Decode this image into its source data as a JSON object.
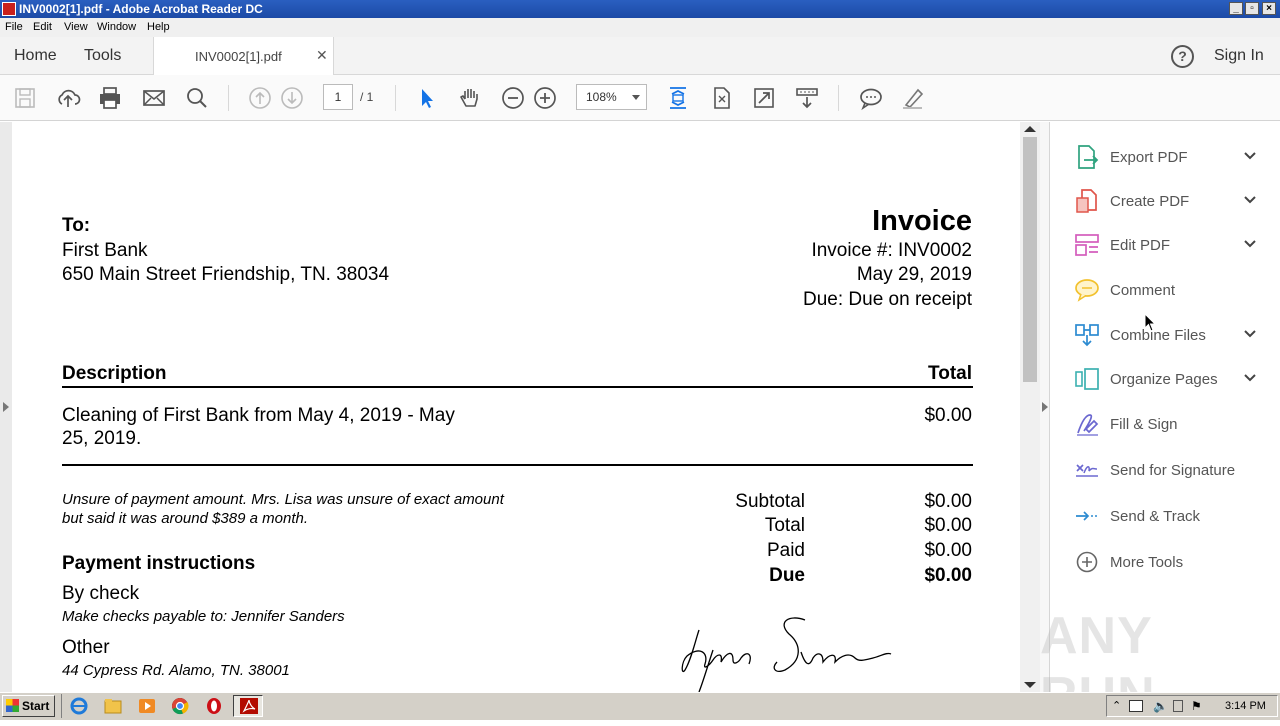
{
  "window": {
    "title": "INV0002[1].pdf - Adobe Acrobat Reader DC"
  },
  "menu": [
    "File",
    "Edit",
    "View",
    "Window",
    "Help"
  ],
  "tabs": {
    "home": "Home",
    "tools": "Tools",
    "doc": "INV0002[1].pdf",
    "sign_in": "Sign In"
  },
  "toolbar": {
    "page_current": "1",
    "page_total": "/ 1",
    "zoom": "108%"
  },
  "invoice": {
    "to_label": "To:",
    "to_name": "First Bank",
    "to_address": "650 Main Street Friendship, TN. 38034",
    "heading": "Invoice",
    "number": "Invoice #: INV0002",
    "date": "May 29, 2019",
    "due": "Due: Due on receipt",
    "col_description": "Description",
    "col_total": "Total",
    "item_line1": "Cleaning of First Bank from May 4, 2019 - May",
    "item_line2": "25, 2019.",
    "item_total": "$0.00",
    "note_line1": "Unsure of payment amount. Mrs. Lisa was unsure of exact amount",
    "note_line2": "but said it was around $389 a month.",
    "summary": [
      {
        "label": "Subtotal",
        "value": "$0.00"
      },
      {
        "label": "Total",
        "value": "$0.00"
      },
      {
        "label": "Paid",
        "value": "$0.00"
      },
      {
        "label": "Due",
        "value": "$0.00"
      }
    ],
    "payment_heading": "Payment instructions",
    "by_check": "By check",
    "check_payable": "Make checks payable to: Jennifer Sanders",
    "other": "Other",
    "other_address": "44 Cypress Rd. Alamo, TN. 38001"
  },
  "tools_panel": [
    {
      "label": "Export PDF",
      "icon": "export-pdf-icon",
      "color": "#2fa37f",
      "chevron": true
    },
    {
      "label": "Create PDF",
      "icon": "create-pdf-icon",
      "color": "#e0564b",
      "chevron": true
    },
    {
      "label": "Edit PDF",
      "icon": "edit-pdf-icon",
      "color": "#d45dbd",
      "chevron": true
    },
    {
      "label": "Comment",
      "icon": "comment-icon",
      "color": "#f2c12e",
      "chevron": false
    },
    {
      "label": "Combine Files",
      "icon": "combine-files-icon",
      "color": "#2d8bd1",
      "chevron": true
    },
    {
      "label": "Organize Pages",
      "icon": "organize-pages-icon",
      "color": "#3cb1b0",
      "chevron": true
    },
    {
      "label": "Fill & Sign",
      "icon": "fill-sign-icon",
      "color": "#6b68d0",
      "chevron": false
    },
    {
      "label": "Send for Signature",
      "icon": "send-for-signature-icon",
      "color": "#6b68d0",
      "chevron": false
    },
    {
      "label": "Send & Track",
      "icon": "send-track-icon",
      "color": "#2d8bd1",
      "chevron": false
    },
    {
      "label": "More Tools",
      "icon": "more-tools-icon",
      "color": "#666666",
      "chevron": false
    }
  ],
  "taskbar": {
    "start": "Start",
    "clock": "3:14 PM"
  },
  "watermark": "ANY RUN"
}
